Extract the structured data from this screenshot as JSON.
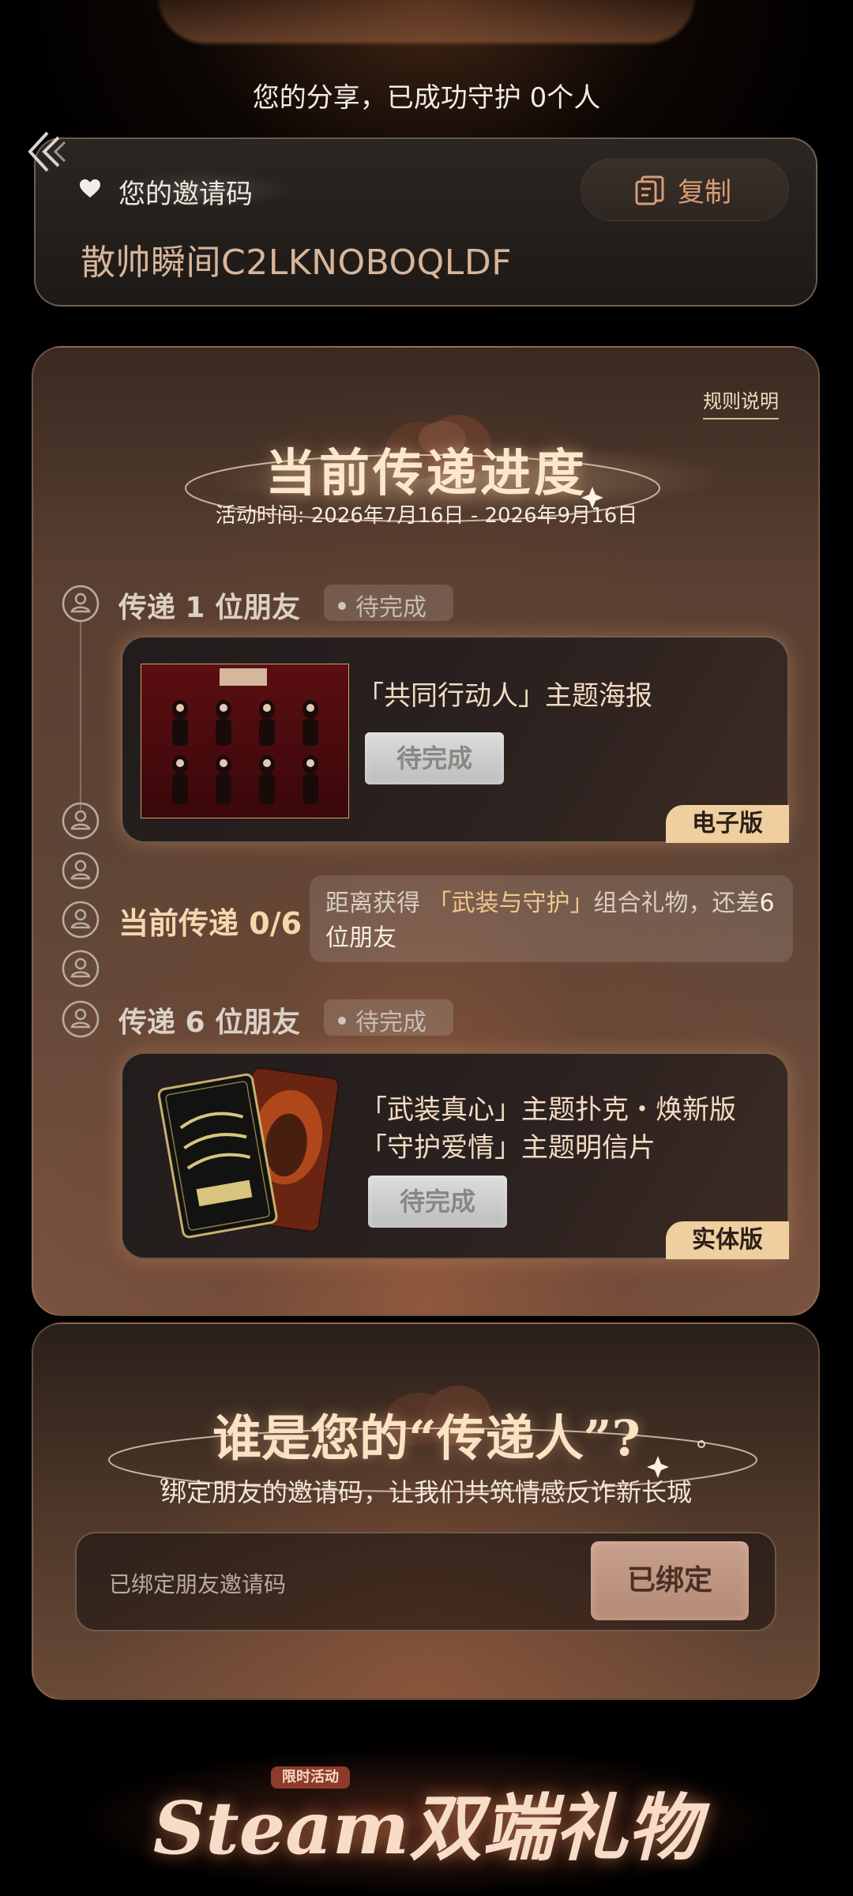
{
  "header": {
    "share_text": "您的分享，已成功守护 0个人"
  },
  "invite": {
    "label": "您的邀请码",
    "code": "散帅瞬间C2LKNOBOQLDF",
    "copy_label": "复制"
  },
  "progress": {
    "rules_link": "规则说明",
    "title": "当前传递进度",
    "activity_time": "活动时间: 2026年7月16日 - 2026年9月16日",
    "step1": {
      "title": "传递 1 位朋友",
      "status": "待完成",
      "reward_title": "「共同行动人」主题海报",
      "button": "待完成",
      "tag": "电子版"
    },
    "current": {
      "label": "当前传递",
      "count": "0/6",
      "info_prefix": "距离获得",
      "info_gift": "「武装与守护」",
      "info_mid": "组合礼物，还差",
      "info_count": "6位朋友"
    },
    "step6": {
      "title": "传递 6 位朋友",
      "status": "待完成",
      "reward_line1": "「武装真心」主题扑克・焕新版",
      "reward_line2": "「守护爱情」主题明信片",
      "button": "待完成",
      "tag": "实体版"
    }
  },
  "bind": {
    "title": "谁是您的“传递人”?",
    "subtitle": "绑定朋友的邀请码，让我们共筑情感反诈新长城",
    "placeholder": "已绑定朋友邀请码",
    "button": "已绑定"
  },
  "footer": {
    "badge": "限时活动",
    "title": "Steam双端礼物"
  },
  "colors": {
    "accent": "#f0c78f",
    "tag_bg": "#efcf9f",
    "copy_text": "#d99c74"
  }
}
